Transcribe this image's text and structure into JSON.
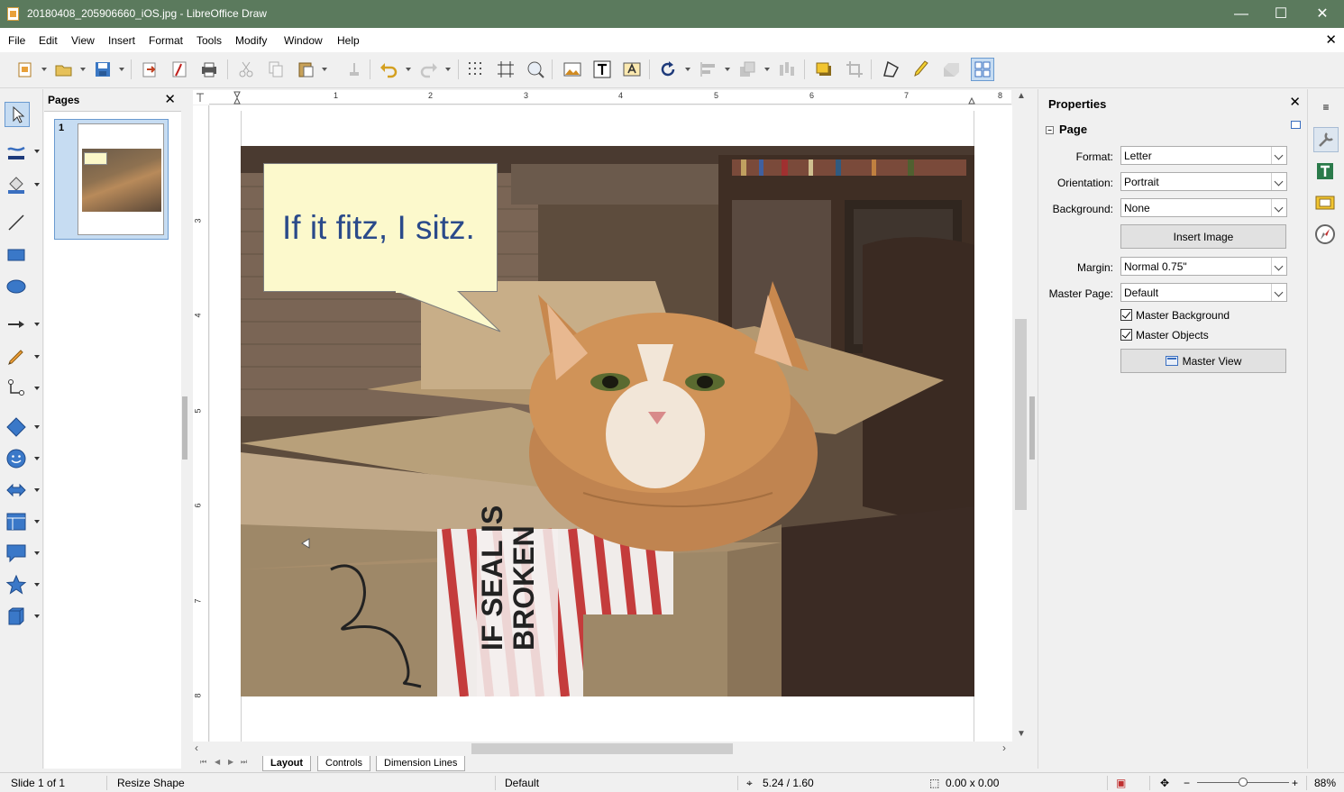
{
  "window": {
    "title": "20180408_205906660_iOS.jpg - LibreOffice Draw",
    "minimize": "—",
    "maximize": "☐",
    "close": "✕"
  },
  "menu": {
    "items": [
      "File",
      "Edit",
      "View",
      "Insert",
      "Format",
      "Tools",
      "Modify",
      "Window",
      "Help"
    ],
    "close_document": "✕"
  },
  "pages_pane": {
    "title": "Pages",
    "close": "✕",
    "pages": [
      {
        "number": "1"
      }
    ]
  },
  "canvas": {
    "bubble_text": "If it fitz, I sitz.",
    "ruler_numbers": [
      "1",
      "2",
      "3",
      "4",
      "5",
      "6",
      "7",
      "8"
    ],
    "vruler_numbers": [
      "3",
      "4",
      "5",
      "6",
      "7",
      "8"
    ]
  },
  "tabs": {
    "items": [
      "Layout",
      "Controls",
      "Dimension Lines"
    ],
    "active": "Layout"
  },
  "sidebar": {
    "title": "Properties",
    "close": "✕",
    "section": "Page",
    "section_toggle": "−",
    "format_label": "Format:",
    "format_value": "Letter",
    "orientation_label": "Orientation:",
    "orientation_value": "Portrait",
    "background_label": "Background:",
    "background_value": "None",
    "insert_image": "Insert Image",
    "margin_label": "Margin:",
    "margin_value": "Normal 0.75\"",
    "master_page_label": "Master Page:",
    "master_page_value": "Default",
    "master_background": "Master Background",
    "master_objects": "Master Objects",
    "master_view": "Master View"
  },
  "statusbar": {
    "slide": "Slide 1 of 1",
    "action": "Resize Shape",
    "master": "Default",
    "position": "5.24 / 1.60",
    "size": "0.00 x 0.00",
    "zoom_minus": "−",
    "zoom_plus": "+",
    "zoom": "88%"
  },
  "colors": {
    "titlebar": "#5b7a5d",
    "bubble_fill": "#fcf9cc",
    "bubble_text": "#2a4a8a",
    "selection": "#c6dcf2"
  },
  "icons": {
    "toolbar": [
      "new-icon",
      "open-icon",
      "save-icon",
      "export-icon",
      "export-pdf-icon",
      "print-icon",
      "cut-icon",
      "copy-icon",
      "paste-icon",
      "clone-formatting-icon",
      "undo-icon",
      "redo-icon",
      "grid-icon",
      "helplines-icon",
      "zoom-pan-icon",
      "image-icon",
      "textbox-icon",
      "fontwork-icon",
      "rotate-icon",
      "align-icon",
      "arrange-icon",
      "distribute-icon",
      "shadow-icon",
      "crop-icon",
      "points-icon",
      "glue-points-icon",
      "toggle-extrusion-icon",
      "select-mode-icon"
    ],
    "drawing": [
      "select-icon",
      "line-color-icon",
      "fill-color-icon",
      "line-icon",
      "rectangle-icon",
      "ellipse-icon",
      "line-arrow-icon",
      "curve-icon",
      "connector-icon",
      "basic-shapes-icon",
      "symbol-shapes-icon",
      "block-arrows-icon",
      "flowchart-icon",
      "callouts-icon",
      "stars-icon",
      "3d-objects-icon"
    ],
    "deck": [
      "sidebar-menu-icon",
      "properties-deck-icon",
      "styles-deck-icon",
      "gallery-deck-icon",
      "navigator-deck-icon"
    ]
  }
}
